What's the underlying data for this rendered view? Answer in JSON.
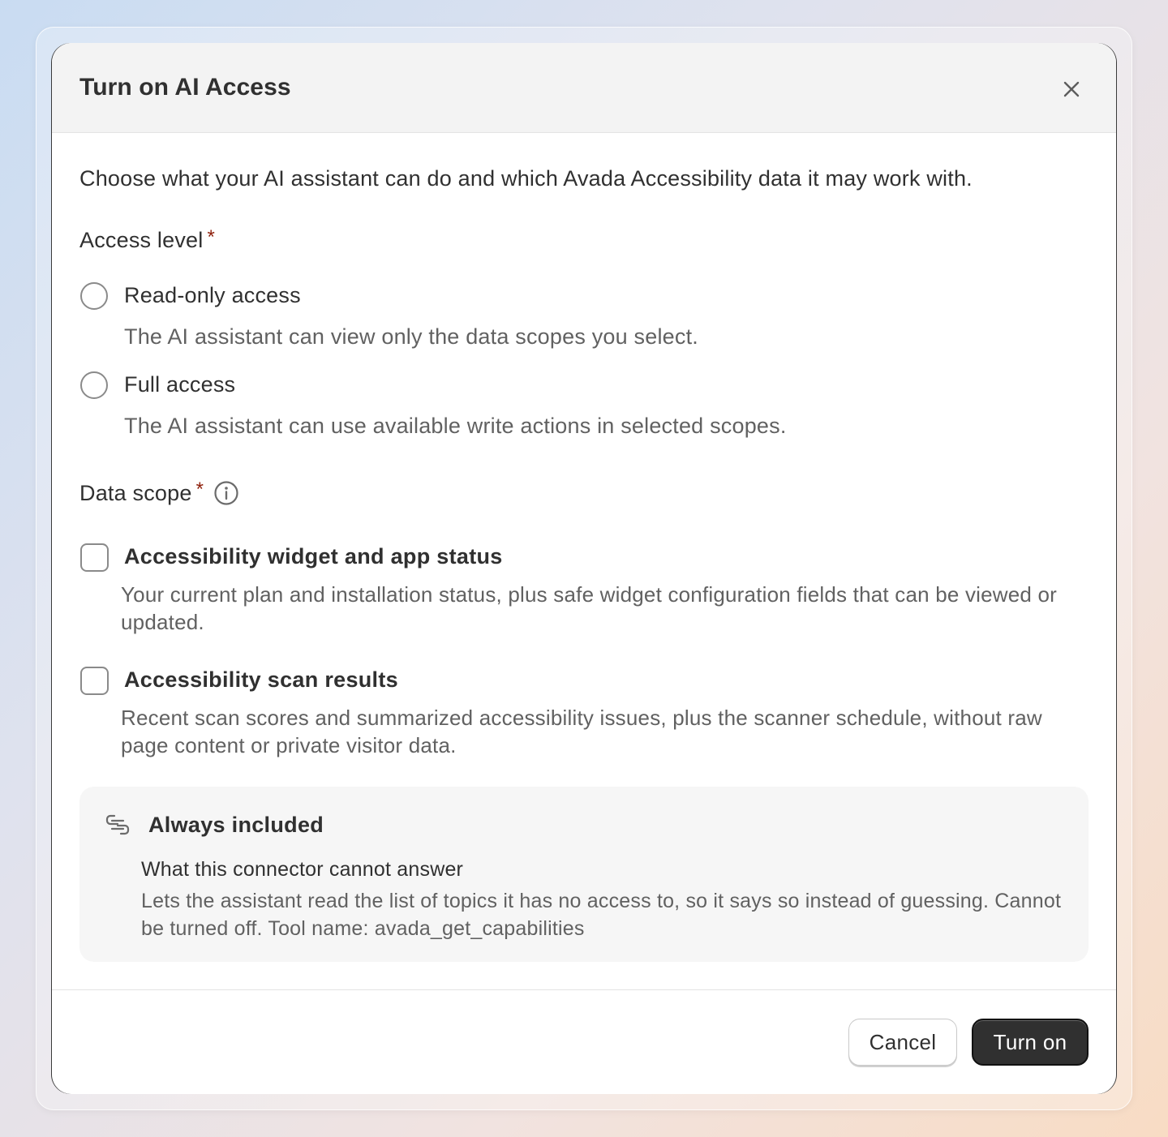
{
  "modal": {
    "title": "Turn on AI Access",
    "intro": "Choose what your AI assistant can do and which Avada Accessibility data it may work with."
  },
  "access_level": {
    "label": "Access level",
    "required_mark": "*",
    "options": [
      {
        "title": "Read-only access",
        "description": "The AI assistant can view only the data scopes you select.",
        "selected": false
      },
      {
        "title": "Full access",
        "description": "The AI assistant can use available write actions in selected scopes.",
        "selected": false
      }
    ]
  },
  "data_scope": {
    "label": "Data scope",
    "required_mark": "*",
    "info_icon": "info-circle-icon",
    "options": [
      {
        "title": "Accessibility widget and app status",
        "description": "Your current plan and installation status, plus safe widget configuration fields that can be viewed or updated.",
        "checked": false
      },
      {
        "title": "Accessibility scan results",
        "description": "Recent scan scores and summarized accessibility issues, plus the scanner schedule, without raw page content or private visitor data.",
        "checked": false
      }
    ]
  },
  "always_included": {
    "title": "Always included",
    "icon": "link-icon",
    "item_title": "What this connector cannot answer",
    "item_description": "Lets the assistant read the list of topics it has no access to, so it says so instead of guessing. Cannot be turned off. Tool name: avada_get_capabilities"
  },
  "footer": {
    "cancel_label": "Cancel",
    "confirm_label": "Turn on"
  },
  "colors": {
    "required": "#8e1f0b",
    "primary_button": "#303030",
    "header_bg": "#f3f3f3"
  }
}
